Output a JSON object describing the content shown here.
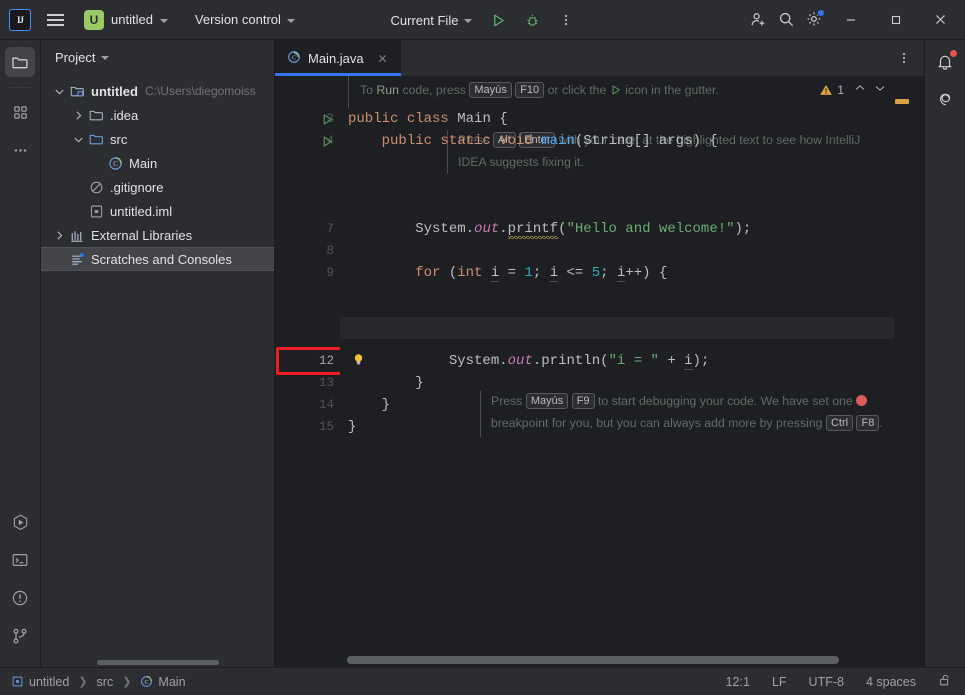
{
  "titlebar": {
    "logo_text": "IJ",
    "logo_icon": "intellij-logo-icon",
    "menu_icon": "hamburger-menu-icon",
    "project_initial": "U",
    "project_name": "untitled",
    "vcs_label": "Version control",
    "run_config": "Current File",
    "run_icon": "run-play-icon",
    "debug_icon": "debug-bug-icon",
    "more_icon": "more-vertical-icon",
    "invite_icon": "add-user-icon",
    "search_icon": "search-icon",
    "settings_icon": "gear-icon",
    "minimize_icon": "minimize-icon",
    "maximize_icon": "maximize-icon",
    "close_icon": "close-icon"
  },
  "left_rail": [
    {
      "name": "project-tool-window",
      "icon": "folder-icon",
      "active": true
    },
    {
      "name": "structure-tool-window",
      "icon": "grid-squares-icon",
      "active": false
    },
    {
      "name": "more-tool-windows",
      "icon": "ellipsis-icon",
      "active": false
    }
  ],
  "left_rail_bottom": [
    {
      "name": "run-tool-window",
      "icon": "run-hexagon-icon"
    },
    {
      "name": "terminal-tool-window",
      "icon": "terminal-icon"
    },
    {
      "name": "problems-tool-window",
      "icon": "warning-circle-icon"
    },
    {
      "name": "version-control-tool-window",
      "icon": "git-branch-icon"
    }
  ],
  "right_rail": [
    {
      "name": "notifications",
      "icon": "bell-icon",
      "badge": true
    },
    {
      "name": "ai-assistant",
      "icon": "ai-swirl-icon",
      "badge": false
    }
  ],
  "project_panel": {
    "title": "Project",
    "title_chevron": "chevron-down-icon",
    "tree": [
      {
        "label": "untitled",
        "path": "C:\\Users\\diegomoiss",
        "icon": "module-folder-icon",
        "indent": 0,
        "arrow": "expanded",
        "bold": true,
        "selected": false
      },
      {
        "label": ".idea",
        "path": "",
        "icon": "folder-icon",
        "indent": 1,
        "arrow": "collapsed",
        "bold": false,
        "selected": false
      },
      {
        "label": "src",
        "path": "",
        "icon": "source-folder-icon",
        "indent": 1,
        "arrow": "expanded",
        "bold": false,
        "selected": false
      },
      {
        "label": "Main",
        "path": "",
        "icon": "java-class-icon",
        "indent": 2,
        "arrow": "none",
        "bold": false,
        "selected": false
      },
      {
        "label": ".gitignore",
        "path": "",
        "icon": "gitignore-icon",
        "indent": 1,
        "arrow": "none",
        "bold": false,
        "selected": false
      },
      {
        "label": "untitled.iml",
        "path": "",
        "icon": "iml-file-icon",
        "indent": 1,
        "arrow": "none",
        "bold": false,
        "selected": false
      },
      {
        "label": "External Libraries",
        "path": "",
        "icon": "library-icon",
        "indent": 0,
        "arrow": "collapsed",
        "bold": false,
        "selected": false
      },
      {
        "label": "Scratches and Consoles",
        "path": "",
        "icon": "scratches-icon",
        "indent": 0,
        "arrow": "none",
        "bold": false,
        "selected": true
      }
    ]
  },
  "editor": {
    "tab": {
      "label": "Main.java",
      "icon": "java-class-icon",
      "close_icon": "close-icon"
    },
    "tab_more_icon": "more-vertical-icon",
    "notification": {
      "prefix": "To ",
      "run_word": "Run",
      "mid": " code, press ",
      "key1": "Mayús",
      "key2": "F10",
      "mid2": " or click the ",
      "suffix": " icon in the gutter.",
      "warning_count": "1",
      "warning_icon": "warning-triangle-icon",
      "prev_icon": "chevron-up-icon",
      "next_icon": "chevron-down-icon"
    },
    "inlay_alt_enter": {
      "prefix": "Press ",
      "key1": "Alt",
      "key2": "Enter",
      "line1_tail": " with your caret at the highlighted text to see how IntelliJ",
      "line2": "IDEA suggests fixing it."
    },
    "inlay_debug": {
      "prefix": "Press ",
      "key1": "Mayús",
      "key2": "F9",
      "line1_tail": " to start debugging your code. We have set one ",
      "line2_head": "breakpoint for you, but you can always add more by pressing ",
      "key3": "Ctrl",
      "key4": "F8",
      "line2_tail": "."
    },
    "gutter_lines": [
      "3",
      "4",
      "",
      "",
      "",
      "7",
      "8",
      "9",
      "",
      "",
      "",
      "12",
      "13",
      "14",
      "15"
    ],
    "current_line_number": "12",
    "run_markers_on": [
      "3",
      "4"
    ],
    "bulb_icon": "intention-bulb-icon",
    "code_lines": [
      {
        "n": "3",
        "indent": 0,
        "tokens": [
          {
            "t": "public ",
            "c": "kw"
          },
          {
            "t": "class ",
            "c": "kw"
          },
          {
            "t": "Main",
            "c": "cls"
          },
          {
            "t": " {",
            "c": "pln"
          }
        ]
      },
      {
        "n": "4",
        "indent": 1,
        "tokens": [
          {
            "t": "public ",
            "c": "kw"
          },
          {
            "t": "static ",
            "c": "kw"
          },
          {
            "t": "void ",
            "c": "kw"
          },
          {
            "t": "main",
            "c": "mthb"
          },
          {
            "t": "(String[] args) {",
            "c": "pln"
          }
        ]
      },
      {
        "n": "7",
        "indent": 2,
        "tokens": [
          {
            "t": "System",
            "c": "cls"
          },
          {
            "t": ".",
            "c": "pln"
          },
          {
            "t": "out",
            "c": "fld"
          },
          {
            "t": ".",
            "c": "pln"
          },
          {
            "t": "printf",
            "c": "squig"
          },
          {
            "t": "(",
            "c": "pln"
          },
          {
            "t": "\"Hello and welcome!\"",
            "c": "str"
          },
          {
            "t": ");",
            "c": "pln"
          }
        ]
      },
      {
        "n": "9",
        "indent": 2,
        "tokens": [
          {
            "t": "for",
            "c": "kw"
          },
          {
            "t": " (",
            "c": "pln"
          },
          {
            "t": "int ",
            "c": "kw"
          },
          {
            "t": "i",
            "c": "und"
          },
          {
            "t": " = ",
            "c": "pln"
          },
          {
            "t": "1",
            "c": "num"
          },
          {
            "t": "; ",
            "c": "pln"
          },
          {
            "t": "i",
            "c": "und"
          },
          {
            "t": " <= ",
            "c": "pln"
          },
          {
            "t": "5",
            "c": "num"
          },
          {
            "t": "; ",
            "c": "pln"
          },
          {
            "t": "i",
            "c": "und"
          },
          {
            "t": "++) {",
            "c": "pln"
          }
        ]
      },
      {
        "n": "12",
        "indent": 3,
        "tokens": [
          {
            "t": "System",
            "c": "cls"
          },
          {
            "t": ".",
            "c": "pln"
          },
          {
            "t": "out",
            "c": "fld"
          },
          {
            "t": ".",
            "c": "pln"
          },
          {
            "t": "println",
            "c": "pln"
          },
          {
            "t": "(",
            "c": "pln"
          },
          {
            "t": "\"i = \"",
            "c": "str"
          },
          {
            "t": " + ",
            "c": "pln"
          },
          {
            "t": "i",
            "c": "und"
          },
          {
            "t": ");",
            "c": "pln"
          }
        ]
      },
      {
        "n": "13",
        "indent": 2,
        "tokens": [
          {
            "t": "}",
            "c": "pln"
          }
        ]
      },
      {
        "n": "14",
        "indent": 1,
        "tokens": [
          {
            "t": "}",
            "c": "pln"
          }
        ]
      },
      {
        "n": "15",
        "indent": 0,
        "tokens": [
          {
            "t": "}",
            "c": "pln"
          }
        ]
      }
    ]
  },
  "status_bar": {
    "breadcrumb": [
      {
        "label": "untitled",
        "icon": "module-icon"
      },
      {
        "label": "src",
        "icon": "none"
      },
      {
        "label": "Main",
        "icon": "java-class-icon"
      }
    ],
    "caret_position": "12:1",
    "line_separator": "LF",
    "encoding": "UTF-8",
    "indent": "4 spaces",
    "lock_icon": "unlocked-padlock-icon"
  },
  "colors": {
    "accent": "#3574f0",
    "avatar": "#9aca64",
    "error_box": "#ee1d24",
    "breakpoint": "#db5c5c",
    "warning": "#d9a343",
    "bg": "#1e1f22",
    "panel": "#2b2d30"
  }
}
